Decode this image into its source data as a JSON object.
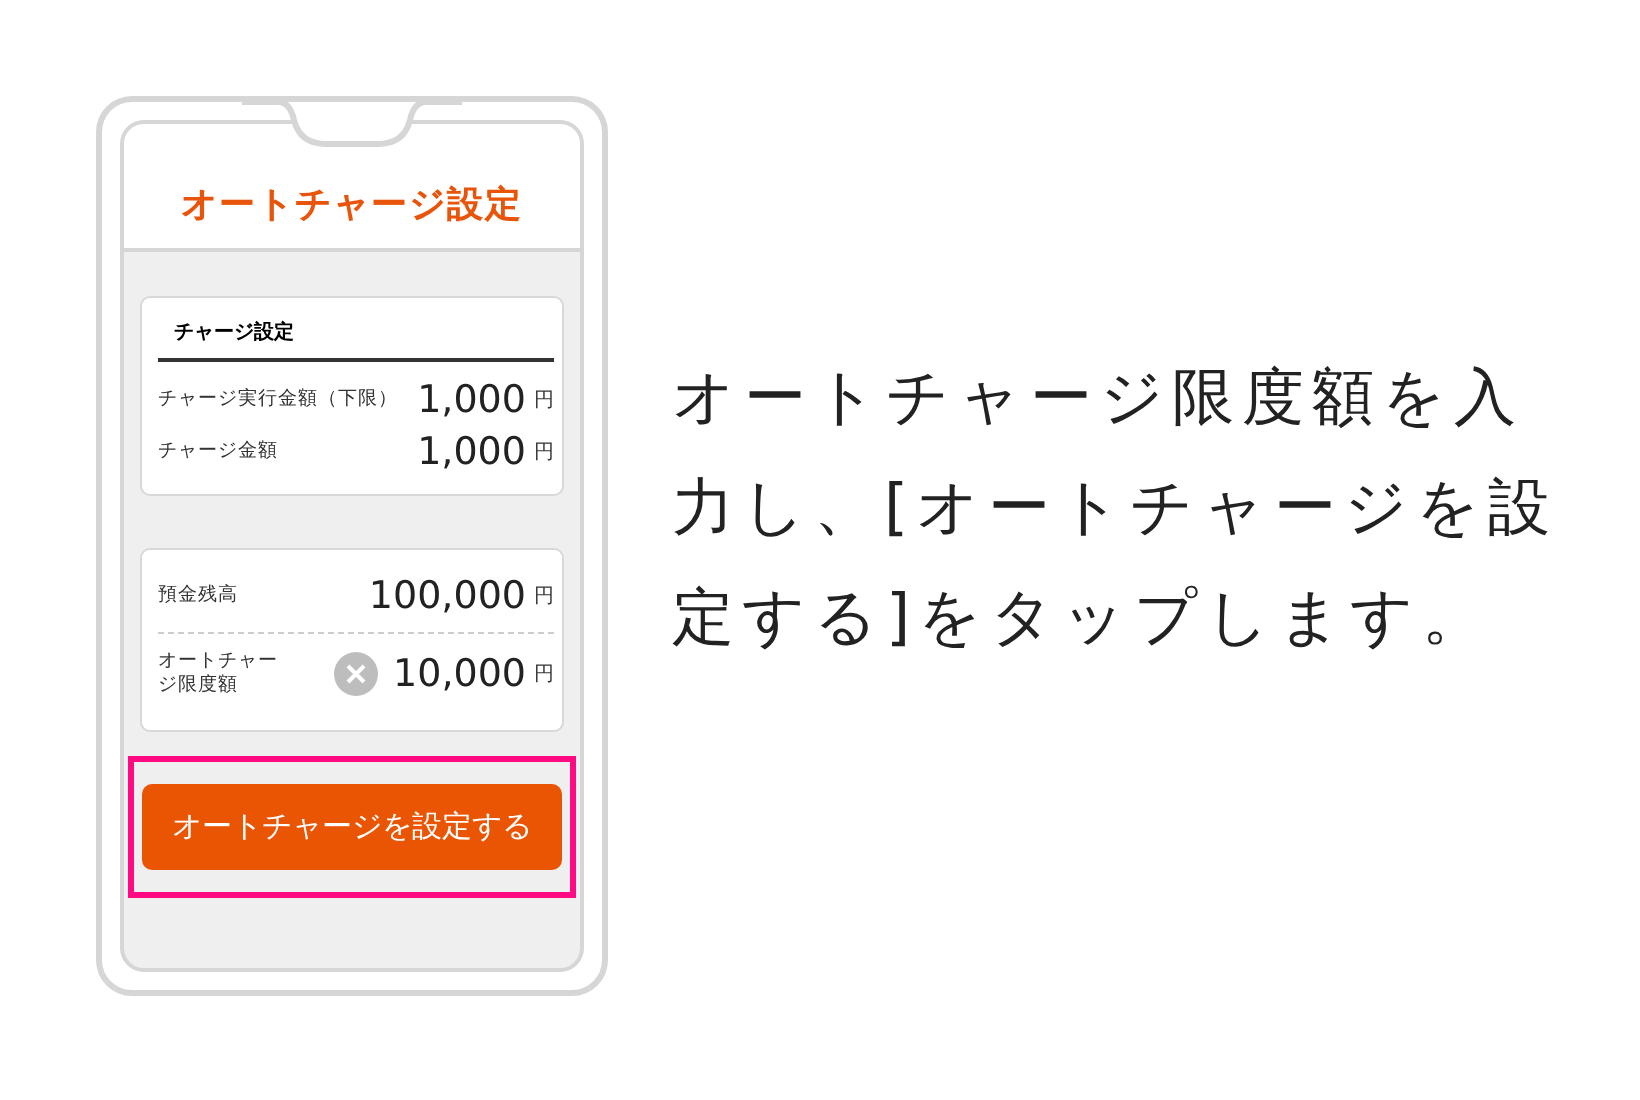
{
  "phone": {
    "title": "オートチャージ設定",
    "charge_card": {
      "heading": "チャージ設定",
      "rows": [
        {
          "label": "チャージ実行金額（下限）",
          "value": "1,000",
          "unit": "円"
        },
        {
          "label": "チャージ金額",
          "value": "1,000",
          "unit": "円"
        }
      ]
    },
    "limit_card": {
      "rows": [
        {
          "kind": "text",
          "label": "預金残高",
          "value": "100,000",
          "unit": "円"
        },
        {
          "kind": "field",
          "label": "オートチャージ限度額",
          "value": "10,000",
          "unit": "円"
        }
      ]
    },
    "button": {
      "label": "オートチャージを設定する",
      "highlighted": true
    }
  },
  "instruction": "オートチャージ限度額を入力し、[オートチャージを設定する]をタップします。"
}
